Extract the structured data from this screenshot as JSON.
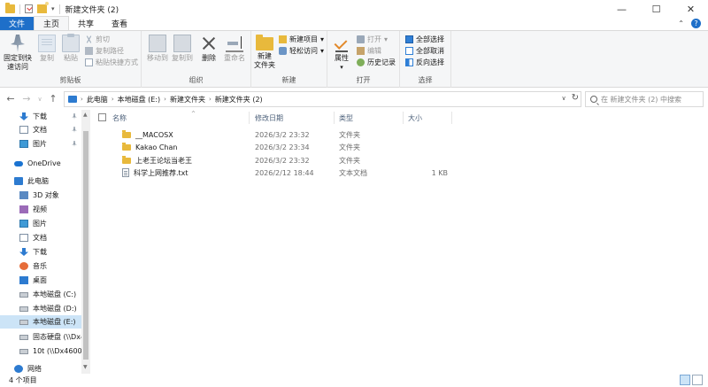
{
  "window": {
    "title": "新建文件夹 (2)",
    "controls": {
      "minimize": "—",
      "maximize": "☐",
      "close": "✕"
    }
  },
  "ribbon_tabs": [
    "文件",
    "主页",
    "共享",
    "查看"
  ],
  "ribbon": {
    "clipboard": {
      "pin_quick_access": "固定到快\n速访问",
      "copy": "复制",
      "paste": "粘贴",
      "cut": "剪切",
      "copy_path": "复制路径",
      "paste_shortcut": "粘贴快捷方式",
      "label": "剪贴板"
    },
    "organize": {
      "move_to": "移动到",
      "copy_to": "复制到",
      "delete": "删除",
      "rename": "重命名",
      "label": "组织"
    },
    "new": {
      "new_folder": "新建\n文件夹",
      "new_item": "新建项目",
      "easy_access": "轻松访问",
      "label": "新建"
    },
    "open": {
      "properties": "属性",
      "open": "打开",
      "edit": "编辑",
      "history": "历史记录",
      "label": "打开"
    },
    "select": {
      "select_all": "全部选择",
      "select_none": "全部取消",
      "invert": "反向选择",
      "label": "选择"
    }
  },
  "address": {
    "crumbs": [
      "此电脑",
      "本地磁盘 (E:)",
      "新建文件夹",
      "新建文件夹 (2)"
    ],
    "search_placeholder": "在 新建文件夹 (2) 中搜索"
  },
  "sidebar": {
    "items": [
      {
        "label": "下载",
        "icon": "download-icon",
        "pinned": true
      },
      {
        "label": "文档",
        "icon": "document-icon",
        "pinned": true
      },
      {
        "label": "图片",
        "icon": "picture-icon",
        "pinned": true
      },
      {
        "label": "OneDrive",
        "icon": "cloud-icon",
        "pinned": false
      },
      {
        "label": "此电脑",
        "icon": "computer-icon",
        "pinned": false
      },
      {
        "label": "3D 对象",
        "icon": "3d-objects-icon",
        "pinned": false
      },
      {
        "label": "视频",
        "icon": "video-icon",
        "pinned": false
      },
      {
        "label": "图片",
        "icon": "picture-icon",
        "pinned": false
      },
      {
        "label": "文档",
        "icon": "document-icon",
        "pinned": false
      },
      {
        "label": "下载",
        "icon": "download-icon",
        "pinned": false
      },
      {
        "label": "音乐",
        "icon": "music-icon",
        "pinned": false
      },
      {
        "label": "桌面",
        "icon": "desktop-icon",
        "pinned": false
      },
      {
        "label": "本地磁盘 (C:)",
        "icon": "drive-icon",
        "pinned": false
      },
      {
        "label": "本地磁盘 (D:)",
        "icon": "drive-icon",
        "pinned": false
      },
      {
        "label": "本地磁盘 (E:)",
        "icon": "drive-icon",
        "pinned": false,
        "selected": true
      },
      {
        "label": "固态硬盘 (\\\\Dx4",
        "icon": "network-drive-icon",
        "pinned": false
      },
      {
        "label": "10t (\\\\Dx4600-",
        "icon": "network-drive-icon",
        "pinned": false
      },
      {
        "label": "网络",
        "icon": "network-icon",
        "pinned": false
      }
    ]
  },
  "columns": {
    "name": "名称",
    "date": "修改日期",
    "type": "类型",
    "size": "大小"
  },
  "files": [
    {
      "name": "__MACOSX",
      "date": "2026/3/2 23:32",
      "type": "文件夹",
      "size": "",
      "kind": "folder"
    },
    {
      "name": "Kakao Chan",
      "date": "2026/3/2 23:34",
      "type": "文件夹",
      "size": "",
      "kind": "folder"
    },
    {
      "name": "上老王论坛当老王",
      "date": "2026/3/2 23:32",
      "type": "文件夹",
      "size": "",
      "kind": "folder"
    },
    {
      "name": "科学上网推荐.txt",
      "date": "2026/2/12 18:44",
      "type": "文本文档",
      "size": "1 KB",
      "kind": "txt"
    }
  ],
  "status": {
    "count": "4 个项目"
  }
}
